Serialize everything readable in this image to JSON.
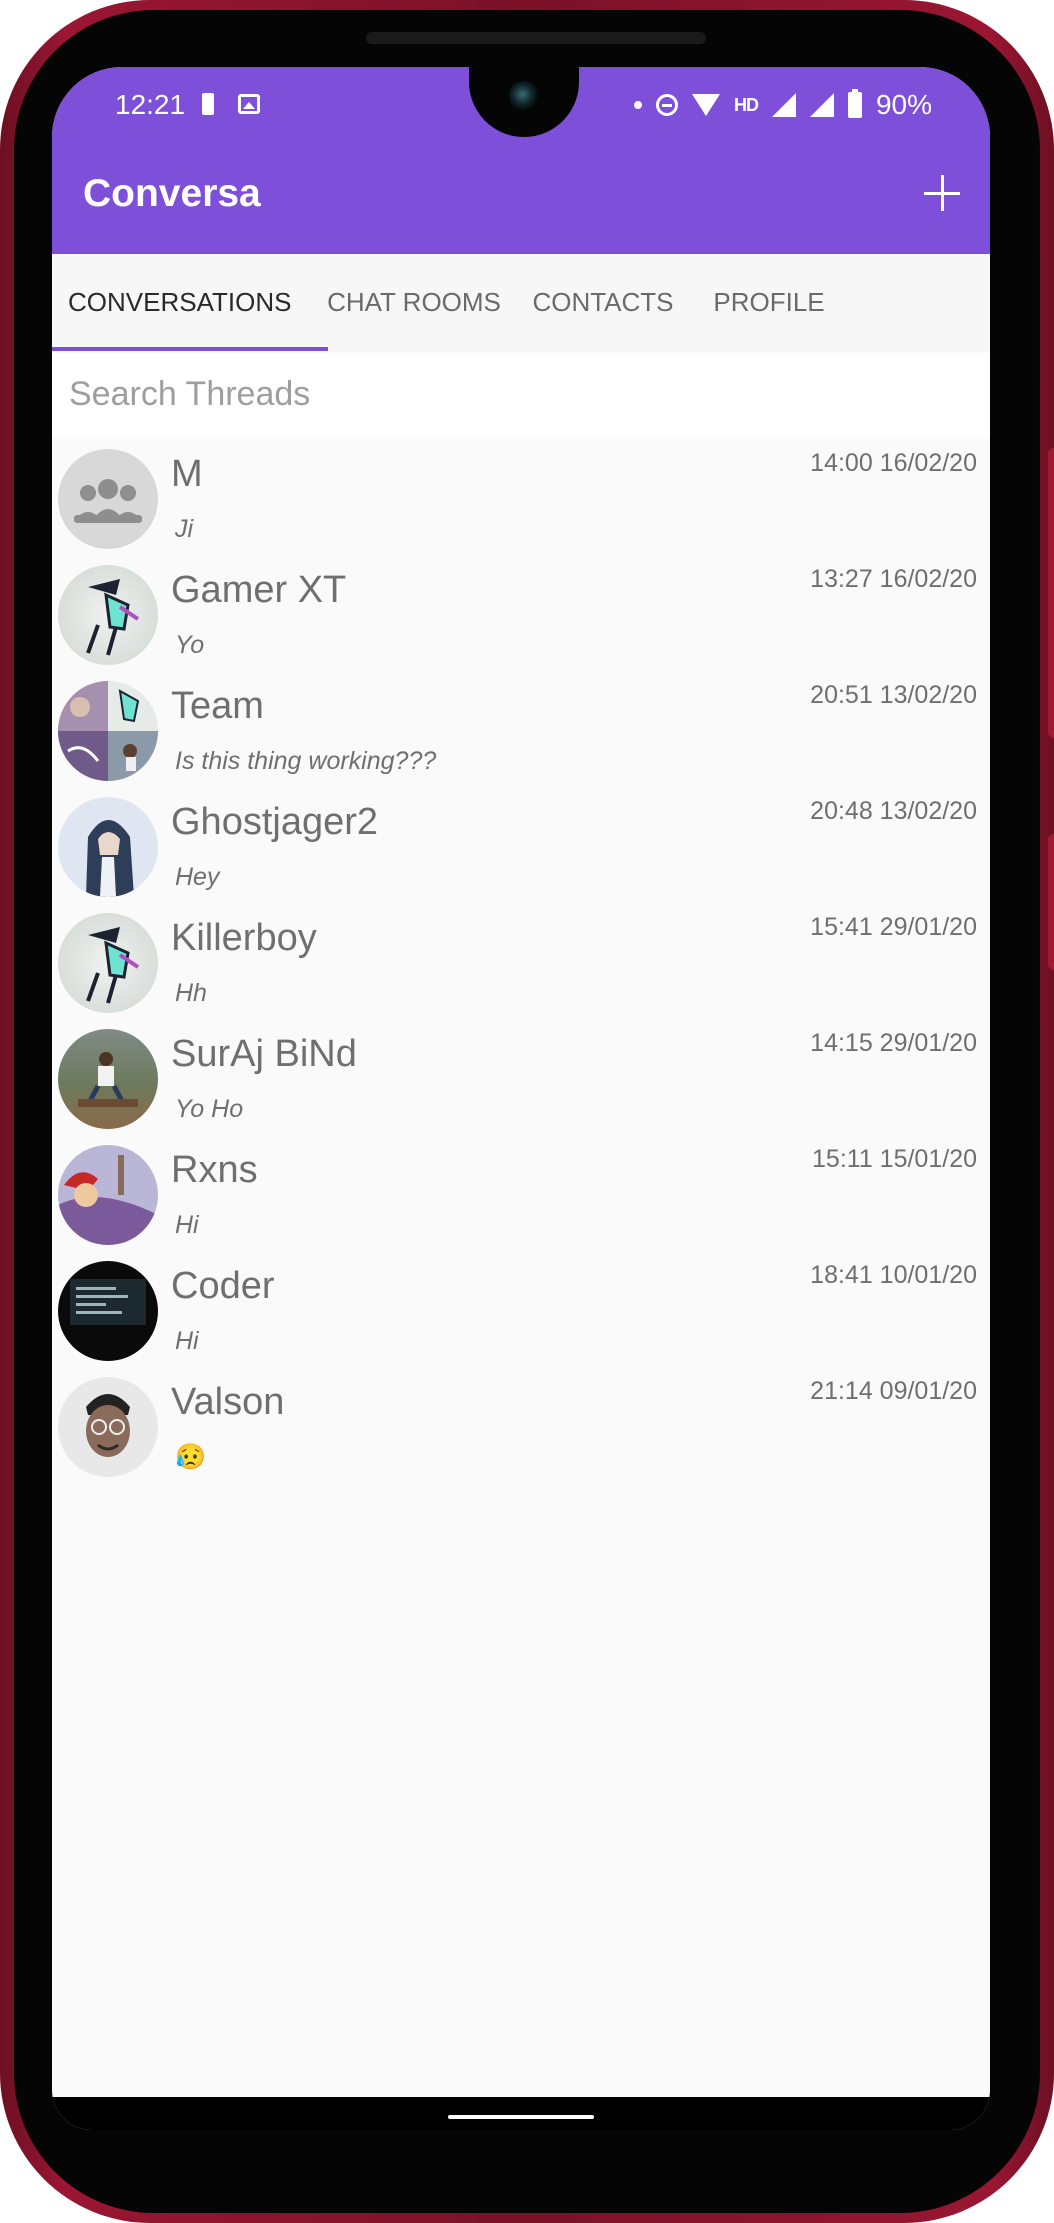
{
  "status_bar": {
    "time": "12:21",
    "hd": "HD",
    "battery": "90%"
  },
  "app_bar": {
    "title": "Conversa"
  },
  "tabs": [
    {
      "label": "CONVERSATIONS",
      "active": true
    },
    {
      "label": "CHAT ROOMS",
      "active": false
    },
    {
      "label": "CONTACTS",
      "active": false
    },
    {
      "label": "PROFILE",
      "active": false
    }
  ],
  "search": {
    "placeholder": "Search Threads"
  },
  "threads": [
    {
      "name": "M",
      "preview": "Ji",
      "stamp": "14:00 16/02/20"
    },
    {
      "name": "Gamer XT",
      "preview": "Yo",
      "stamp": "13:27 16/02/20"
    },
    {
      "name": "Team",
      "preview": "Is this thing working???",
      "stamp": "20:51 13/02/20"
    },
    {
      "name": "Ghostjager2",
      "preview": "Hey",
      "stamp": "20:48 13/02/20"
    },
    {
      "name": "Killerboy",
      "preview": "Hh",
      "stamp": "15:41 29/01/20"
    },
    {
      "name": "SurAj BiNd",
      "preview": "Yo Ho",
      "stamp": "14:15 29/01/20"
    },
    {
      "name": "Rxns",
      "preview": "Hi",
      "stamp": "15:11 15/01/20"
    },
    {
      "name": "Coder",
      "preview": "Hi",
      "stamp": "18:41 10/01/20"
    },
    {
      "name": "Valson",
      "preview": "😥",
      "stamp": "21:14 09/01/20"
    }
  ],
  "colors": {
    "accent": "#7e4fd8",
    "frame": "#8b1530"
  }
}
